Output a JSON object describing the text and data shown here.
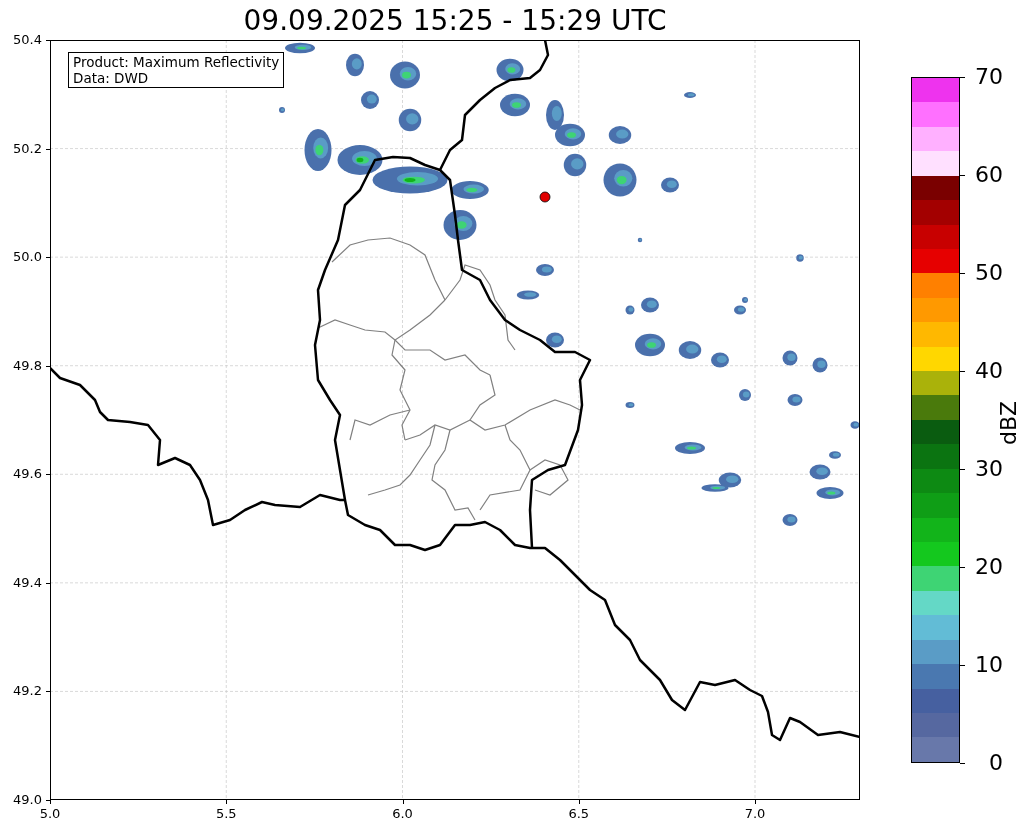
{
  "title": "09.09.2025 15:25 - 15:29 UTC",
  "info_box": {
    "lines": [
      "Product: Maximum Reflectivity",
      "Data: DWD"
    ]
  },
  "map": {
    "x_ticks": [
      "5.0",
      "5.5",
      "6.0",
      "6.5",
      "7.0"
    ],
    "y_ticks": [
      "50.4",
      "50.2",
      "50.0",
      "49.8",
      "49.6",
      "49.4",
      "49.2",
      "49.0"
    ]
  },
  "colorbar": {
    "label": "dBZ",
    "ticks": [
      "70",
      "60",
      "50",
      "40",
      "30",
      "20",
      "10",
      "0"
    ],
    "segments": [
      {
        "color": "#ee33ee"
      },
      {
        "color": "#ff70ff"
      },
      {
        "color": "#ffb0ff"
      },
      {
        "color": "#ffe0ff"
      },
      {
        "color": "#7a0000"
      },
      {
        "color": "#a30000"
      },
      {
        "color": "#c80000"
      },
      {
        "color": "#e60000"
      },
      {
        "color": "#ff8000"
      },
      {
        "color": "#ff9900"
      },
      {
        "color": "#ffb800"
      },
      {
        "color": "#ffd700"
      },
      {
        "color": "#aab20a"
      },
      {
        "color": "#4a7a0c"
      },
      {
        "color": "#0a5c10"
      },
      {
        "color": "#0b7411"
      },
      {
        "color": "#0d8a13"
      },
      {
        "color": "#0f9e16"
      },
      {
        "color": "#12b41a"
      },
      {
        "color": "#14c81e"
      },
      {
        "color": "#3ed474"
      },
      {
        "color": "#64d8c6"
      },
      {
        "color": "#62bcd6"
      },
      {
        "color": "#5a9cc6"
      },
      {
        "color": "#4a78b0"
      },
      {
        "color": "#4660a0"
      },
      {
        "color": "#5668a0"
      },
      {
        "color": "#6878aa"
      }
    ]
  }
}
